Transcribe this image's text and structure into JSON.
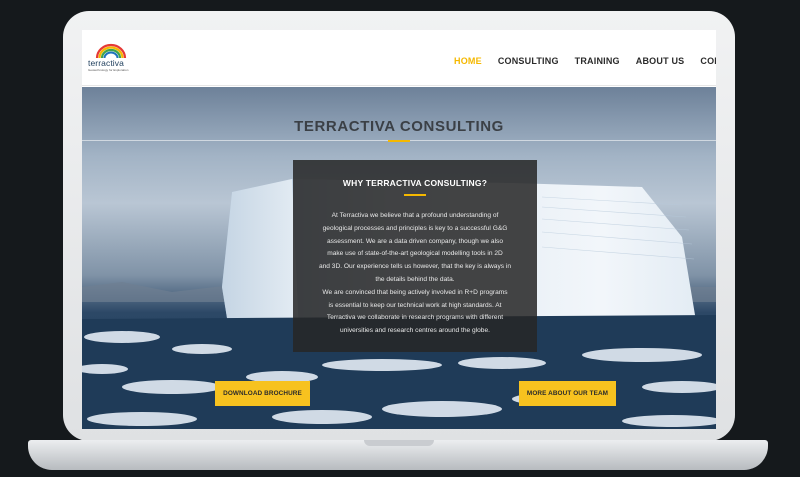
{
  "site": {
    "logo_name": "terractiva",
    "logo_tagline": "Geotechnology for Exploration",
    "nav": [
      {
        "label": "HOME",
        "active": true
      },
      {
        "label": "CONSULTING",
        "active": false
      },
      {
        "label": "TRAINING",
        "active": false
      },
      {
        "label": "ABOUT US",
        "active": false
      },
      {
        "label": "CONTACT",
        "active": false
      }
    ]
  },
  "hero": {
    "title": "TERRACTIVA CONSULTING",
    "box_title": "WHY TERRACTIVA CONSULTING?",
    "box_lines": [
      "At Terractiva we believe that a profound understanding of",
      "geological processes and principles is key to a successful G&G",
      "assessment. We are a data driven company, though we also",
      "make use of state-of-the-art geological modelling tools in 2D",
      "and 3D. Our experience tells us however, that the key is always in",
      "the details behind the data.",
      "We are convinced that being actively involved in R+D programs",
      "is essential to keep our technical work at high standards. At",
      "Terractiva we collaborate in research programs with different",
      "universities and research centres around the globe."
    ],
    "btn_brochure": "DOWNLOAD BROCHURE",
    "btn_team": "MORE ABOUT OUR TEAM"
  },
  "colors": {
    "accent": "#f5b800",
    "button": "#f7c21f",
    "frame_bg": "#15191c"
  },
  "icons": {
    "logo": "rainbow-arc-logo"
  }
}
